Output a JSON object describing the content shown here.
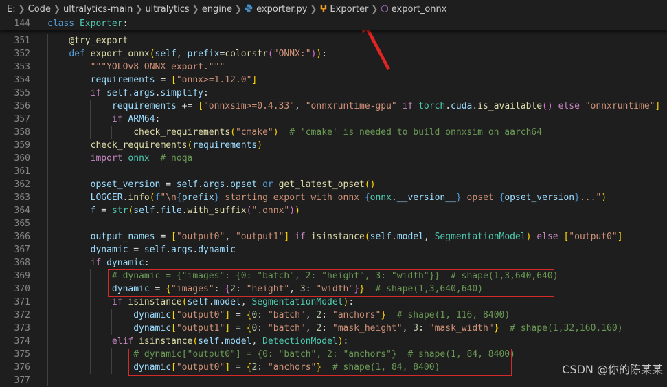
{
  "breadcrumb": {
    "items": [
      "E:",
      "Code",
      "ultralytics-main",
      "ultralytics",
      "engine",
      "exporter.py",
      "Exporter",
      "export_onnx"
    ]
  },
  "editor": {
    "sticky": {
      "line_number": "144",
      "tokens": [
        {
          "t": "class ",
          "c": "kw"
        },
        {
          "t": "Exporter",
          "c": "cls"
        },
        {
          "t": ":",
          "c": "pl"
        }
      ]
    },
    "lines": [
      {
        "n": "351",
        "tokens": [
          {
            "t": "    "
          },
          {
            "t": "@try_export",
            "c": "dec"
          }
        ]
      },
      {
        "n": "352",
        "tokens": [
          {
            "t": "    "
          },
          {
            "t": "def ",
            "c": "kw"
          },
          {
            "t": "export_onnx",
            "c": "fn"
          },
          {
            "t": "(",
            "c": "brk1"
          },
          {
            "t": "self",
            "c": "var"
          },
          {
            "t": ", "
          },
          {
            "t": "prefix",
            "c": "var"
          },
          {
            "t": "="
          },
          {
            "t": "colorstr",
            "c": "fn"
          },
          {
            "t": "(",
            "c": "brk2"
          },
          {
            "t": "\"ONNX:\"",
            "c": "str"
          },
          {
            "t": ")",
            "c": "brk2"
          },
          {
            "t": ")",
            "c": "brk1"
          },
          {
            "t": ":"
          }
        ]
      },
      {
        "n": "353",
        "tokens": [
          {
            "t": "        "
          },
          {
            "t": "\"\"\"YOLOv8 ONNX export.\"\"\"",
            "c": "str"
          }
        ]
      },
      {
        "n": "354",
        "tokens": [
          {
            "t": "        "
          },
          {
            "t": "requirements",
            "c": "var"
          },
          {
            "t": " = "
          },
          {
            "t": "[",
            "c": "brk1"
          },
          {
            "t": "\"onnx>=1.12.0\"",
            "c": "str"
          },
          {
            "t": "]",
            "c": "brk1"
          }
        ]
      },
      {
        "n": "355",
        "tokens": [
          {
            "t": "        "
          },
          {
            "t": "if ",
            "c": "kwc"
          },
          {
            "t": "self",
            "c": "var"
          },
          {
            "t": "."
          },
          {
            "t": "args",
            "c": "var"
          },
          {
            "t": "."
          },
          {
            "t": "simplify",
            "c": "var"
          },
          {
            "t": ":"
          }
        ]
      },
      {
        "n": "356",
        "tokens": [
          {
            "t": "            "
          },
          {
            "t": "requirements",
            "c": "var"
          },
          {
            "t": " += "
          },
          {
            "t": "[",
            "c": "brk1"
          },
          {
            "t": "\"onnxsim>=0.4.33\"",
            "c": "str"
          },
          {
            "t": ", "
          },
          {
            "t": "\"onnxruntime-gpu\"",
            "c": "str"
          },
          {
            "t": " if ",
            "c": "kwc"
          },
          {
            "t": "torch",
            "c": "cls"
          },
          {
            "t": "."
          },
          {
            "t": "cuda",
            "c": "var"
          },
          {
            "t": "."
          },
          {
            "t": "is_available",
            "c": "fn"
          },
          {
            "t": "()",
            "c": "brk2"
          },
          {
            "t": " else ",
            "c": "kwc"
          },
          {
            "t": "\"onnxruntime\"",
            "c": "str"
          },
          {
            "t": "]",
            "c": "brk1"
          }
        ]
      },
      {
        "n": "357",
        "tokens": [
          {
            "t": "            "
          },
          {
            "t": "if ",
            "c": "kwc"
          },
          {
            "t": "ARM64",
            "c": "var"
          },
          {
            "t": ":"
          }
        ]
      },
      {
        "n": "358",
        "tokens": [
          {
            "t": "                "
          },
          {
            "t": "check_requirements",
            "c": "fn"
          },
          {
            "t": "(",
            "c": "brk1"
          },
          {
            "t": "\"cmake\"",
            "c": "str"
          },
          {
            "t": ")",
            "c": "brk1"
          },
          {
            "t": "  "
          },
          {
            "t": "# 'cmake' is needed to build onnxsim on aarch64",
            "c": "cm"
          }
        ]
      },
      {
        "n": "359",
        "tokens": [
          {
            "t": "        "
          },
          {
            "t": "check_requirements",
            "c": "fn"
          },
          {
            "t": "(",
            "c": "brk1"
          },
          {
            "t": "requirements",
            "c": "var"
          },
          {
            "t": ")",
            "c": "brk1"
          }
        ]
      },
      {
        "n": "360",
        "tokens": [
          {
            "t": "        "
          },
          {
            "t": "import ",
            "c": "kwc"
          },
          {
            "t": "onnx",
            "c": "cls"
          },
          {
            "t": "  "
          },
          {
            "t": "# noqa",
            "c": "cm"
          }
        ]
      },
      {
        "n": "361",
        "tokens": []
      },
      {
        "n": "362",
        "tokens": [
          {
            "t": "        "
          },
          {
            "t": "opset_version",
            "c": "var"
          },
          {
            "t": " = "
          },
          {
            "t": "self",
            "c": "var"
          },
          {
            "t": "."
          },
          {
            "t": "args",
            "c": "var"
          },
          {
            "t": "."
          },
          {
            "t": "opset",
            "c": "var"
          },
          {
            "t": " or ",
            "c": "kw"
          },
          {
            "t": "get_latest_opset",
            "c": "fn"
          },
          {
            "t": "()",
            "c": "brk1"
          }
        ]
      },
      {
        "n": "363",
        "tokens": [
          {
            "t": "        "
          },
          {
            "t": "LOGGER",
            "c": "var"
          },
          {
            "t": "."
          },
          {
            "t": "info",
            "c": "fn"
          },
          {
            "t": "(",
            "c": "brk1"
          },
          {
            "t": "f",
            "c": "kw"
          },
          {
            "t": "\"\\n",
            "c": "str"
          },
          {
            "t": "{",
            "c": "kw"
          },
          {
            "t": "prefix",
            "c": "var"
          },
          {
            "t": "}",
            "c": "kw"
          },
          {
            "t": " starting export with onnx ",
            "c": "str"
          },
          {
            "t": "{",
            "c": "kw"
          },
          {
            "t": "onnx",
            "c": "cls"
          },
          {
            "t": "."
          },
          {
            "t": "__version__",
            "c": "var"
          },
          {
            "t": "}",
            "c": "kw"
          },
          {
            "t": " opset ",
            "c": "str"
          },
          {
            "t": "{",
            "c": "kw"
          },
          {
            "t": "opset_version",
            "c": "var"
          },
          {
            "t": "}",
            "c": "kw"
          },
          {
            "t": "...\"",
            "c": "str"
          },
          {
            "t": ")",
            "c": "brk1"
          }
        ]
      },
      {
        "n": "364",
        "tokens": [
          {
            "t": "        "
          },
          {
            "t": "f",
            "c": "var"
          },
          {
            "t": " = "
          },
          {
            "t": "str",
            "c": "cls"
          },
          {
            "t": "(",
            "c": "brk1"
          },
          {
            "t": "self",
            "c": "var"
          },
          {
            "t": "."
          },
          {
            "t": "file",
            "c": "var"
          },
          {
            "t": "."
          },
          {
            "t": "with_suffix",
            "c": "fn"
          },
          {
            "t": "(",
            "c": "brk2"
          },
          {
            "t": "\".onnx\"",
            "c": "str"
          },
          {
            "t": ")",
            "c": "brk2"
          },
          {
            "t": ")",
            "c": "brk1"
          }
        ]
      },
      {
        "n": "365",
        "tokens": []
      },
      {
        "n": "366",
        "tokens": [
          {
            "t": "        "
          },
          {
            "t": "output_names",
            "c": "var"
          },
          {
            "t": " = "
          },
          {
            "t": "[",
            "c": "brk1"
          },
          {
            "t": "\"output0\"",
            "c": "str"
          },
          {
            "t": ", "
          },
          {
            "t": "\"output1\"",
            "c": "str"
          },
          {
            "t": "]",
            "c": "brk1"
          },
          {
            "t": " if ",
            "c": "kwc"
          },
          {
            "t": "isinstance",
            "c": "fn"
          },
          {
            "t": "(",
            "c": "brk1"
          },
          {
            "t": "self",
            "c": "var"
          },
          {
            "t": "."
          },
          {
            "t": "model",
            "c": "var"
          },
          {
            "t": ", "
          },
          {
            "t": "SegmentationModel",
            "c": "cls"
          },
          {
            "t": ")",
            "c": "brk1"
          },
          {
            "t": " else ",
            "c": "kwc"
          },
          {
            "t": "[",
            "c": "brk1"
          },
          {
            "t": "\"output0\"",
            "c": "str"
          },
          {
            "t": "]",
            "c": "brk1"
          }
        ]
      },
      {
        "n": "367",
        "tokens": [
          {
            "t": "        "
          },
          {
            "t": "dynamic",
            "c": "var"
          },
          {
            "t": " = "
          },
          {
            "t": "self",
            "c": "var"
          },
          {
            "t": "."
          },
          {
            "t": "args",
            "c": "var"
          },
          {
            "t": "."
          },
          {
            "t": "dynamic",
            "c": "var"
          }
        ]
      },
      {
        "n": "368",
        "tokens": [
          {
            "t": "        "
          },
          {
            "t": "if ",
            "c": "kwc"
          },
          {
            "t": "dynamic",
            "c": "var"
          },
          {
            "t": ":"
          }
        ]
      },
      {
        "n": "369",
        "tokens": [
          {
            "t": "            "
          },
          {
            "t": "# dynamic = {\"images\": {0: \"batch\", 2: \"height\", 3: \"width\"}}  # shape(1,3,640,640)",
            "c": "cm"
          }
        ]
      },
      {
        "n": "370",
        "tokens": [
          {
            "t": "            "
          },
          {
            "t": "dynamic",
            "c": "var"
          },
          {
            "t": " = "
          },
          {
            "t": "{",
            "c": "brk1"
          },
          {
            "t": "\"images\"",
            "c": "str"
          },
          {
            "t": ": "
          },
          {
            "t": "{",
            "c": "brk2"
          },
          {
            "t": "2",
            "c": "num"
          },
          {
            "t": ": "
          },
          {
            "t": "\"height\"",
            "c": "str"
          },
          {
            "t": ", "
          },
          {
            "t": "3",
            "c": "num"
          },
          {
            "t": ": "
          },
          {
            "t": "\"width\"",
            "c": "str"
          },
          {
            "t": "}",
            "c": "brk2"
          },
          {
            "t": "}",
            "c": "brk1"
          },
          {
            "t": "  "
          },
          {
            "t": "# shape(1,3,640,640)",
            "c": "cm"
          }
        ]
      },
      {
        "n": "371",
        "tokens": [
          {
            "t": "            "
          },
          {
            "t": "if ",
            "c": "kwc"
          },
          {
            "t": "isinstance",
            "c": "fn"
          },
          {
            "t": "(",
            "c": "brk1"
          },
          {
            "t": "self",
            "c": "var"
          },
          {
            "t": "."
          },
          {
            "t": "model",
            "c": "var"
          },
          {
            "t": ", "
          },
          {
            "t": "SegmentationModel",
            "c": "cls"
          },
          {
            "t": ")",
            "c": "brk1"
          },
          {
            "t": ":"
          }
        ]
      },
      {
        "n": "372",
        "tokens": [
          {
            "t": "                "
          },
          {
            "t": "dynamic",
            "c": "var"
          },
          {
            "t": "[",
            "c": "brk1"
          },
          {
            "t": "\"output0\"",
            "c": "str"
          },
          {
            "t": "]",
            "c": "brk1"
          },
          {
            "t": " = "
          },
          {
            "t": "{",
            "c": "brk1"
          },
          {
            "t": "0",
            "c": "num"
          },
          {
            "t": ": "
          },
          {
            "t": "\"batch\"",
            "c": "str"
          },
          {
            "t": ", "
          },
          {
            "t": "2",
            "c": "num"
          },
          {
            "t": ": "
          },
          {
            "t": "\"anchors\"",
            "c": "str"
          },
          {
            "t": "}",
            "c": "brk1"
          },
          {
            "t": "  "
          },
          {
            "t": "# shape(1, 116, 8400)",
            "c": "cm"
          }
        ]
      },
      {
        "n": "373",
        "tokens": [
          {
            "t": "                "
          },
          {
            "t": "dynamic",
            "c": "var"
          },
          {
            "t": "[",
            "c": "brk1"
          },
          {
            "t": "\"output1\"",
            "c": "str"
          },
          {
            "t": "]",
            "c": "brk1"
          },
          {
            "t": " = "
          },
          {
            "t": "{",
            "c": "brk1"
          },
          {
            "t": "0",
            "c": "num"
          },
          {
            "t": ": "
          },
          {
            "t": "\"batch\"",
            "c": "str"
          },
          {
            "t": ", "
          },
          {
            "t": "2",
            "c": "num"
          },
          {
            "t": ": "
          },
          {
            "t": "\"mask_height\"",
            "c": "str"
          },
          {
            "t": ", "
          },
          {
            "t": "3",
            "c": "num"
          },
          {
            "t": ": "
          },
          {
            "t": "\"mask_width\"",
            "c": "str"
          },
          {
            "t": "}",
            "c": "brk1"
          },
          {
            "t": "  "
          },
          {
            "t": "# shape(1,32,160,160)",
            "c": "cm"
          }
        ]
      },
      {
        "n": "374",
        "tokens": [
          {
            "t": "            "
          },
          {
            "t": "elif ",
            "c": "kwc"
          },
          {
            "t": "isinstance",
            "c": "fn"
          },
          {
            "t": "(",
            "c": "brk1"
          },
          {
            "t": "self",
            "c": "var"
          },
          {
            "t": "."
          },
          {
            "t": "model",
            "c": "var"
          },
          {
            "t": ", "
          },
          {
            "t": "DetectionModel",
            "c": "cls"
          },
          {
            "t": ")",
            "c": "brk1"
          },
          {
            "t": ":"
          }
        ]
      },
      {
        "n": "375",
        "tokens": [
          {
            "t": "                "
          },
          {
            "t": "# dynamic[\"output0\"] = {0: \"batch\", 2: \"anchors\"}  # shape(1, 84, 8400)",
            "c": "cm"
          }
        ]
      },
      {
        "n": "376",
        "tokens": [
          {
            "t": "                "
          },
          {
            "t": "dynamic",
            "c": "var"
          },
          {
            "t": "[",
            "c": "brk1"
          },
          {
            "t": "\"output0\"",
            "c": "str"
          },
          {
            "t": "]",
            "c": "brk1"
          },
          {
            "t": " = "
          },
          {
            "t": "{",
            "c": "brk1"
          },
          {
            "t": "2",
            "c": "num"
          },
          {
            "t": ": "
          },
          {
            "t": "\"anchors\"",
            "c": "str"
          },
          {
            "t": "}",
            "c": "brk1"
          },
          {
            "t": "  "
          },
          {
            "t": "# shape(1, 84, 8400)",
            "c": "cm"
          }
        ]
      },
      {
        "n": "377",
        "tokens": []
      }
    ]
  },
  "watermark": "CSDN @你的陈某某",
  "colors": {
    "background": "#1e1e1e",
    "highlight_box": "#d42a2a",
    "arrow": "#e02424"
  }
}
